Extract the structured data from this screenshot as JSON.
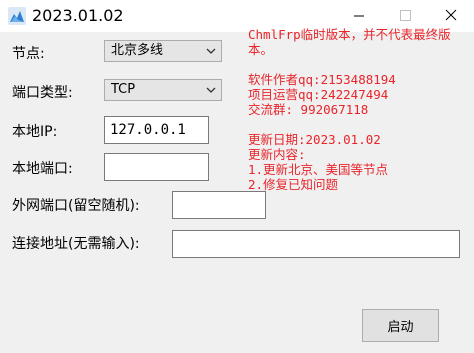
{
  "window": {
    "title": "2023.01.02",
    "icon": "app-logo-icon",
    "controls": [
      "minimize-icon",
      "maximize-icon",
      "close-icon"
    ]
  },
  "form": {
    "node_label": "节点:",
    "node_value": "北京多线",
    "port_type_label": "端口类型:",
    "port_type_value": "TCP",
    "local_ip_label": "本地IP:",
    "local_ip_value": "127.0.0.1",
    "local_port_label": "本地端口:",
    "local_port_value": "",
    "remote_port_label": "外网端口(留空随机):",
    "remote_port_value": "",
    "address_label": "连接地址(无需输入):",
    "address_value": ""
  },
  "notice": {
    "line1": "ChmlFrp临时版本，并不代表最终版",
    "line2": "本。",
    "author": "软件作者qq:2153488194",
    "operator": "项目运营qq:242247494",
    "group": "交流群: 992067118",
    "update_date": "更新日期:2023.01.02",
    "update_title": "更新内容:",
    "update_1": "1.更新北京、美国等节点",
    "update_2": "2.修复已知问题"
  },
  "buttons": {
    "start": "启动"
  },
  "colors": {
    "notice_text": "#e8252b",
    "background": "#f0f0f0"
  }
}
